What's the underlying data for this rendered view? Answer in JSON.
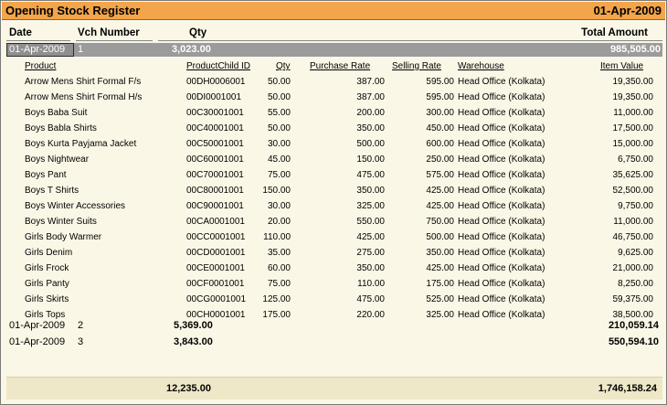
{
  "title": "Opening Stock Register",
  "date": "01-Apr-2009",
  "headers": {
    "date": "Date",
    "vch_number": "Vch Number",
    "qty": "Qty",
    "total_amount": "Total Amount"
  },
  "selected_voucher": {
    "date": "01-Apr-2009",
    "number": "1",
    "qty": "3,023.00",
    "amount": "985,505.00"
  },
  "columns": {
    "product": "Product",
    "child_id": "ProductChild ID",
    "qty": "Qty",
    "purchase_rate": "Purchase Rate",
    "selling_rate": "Selling Rate",
    "warehouse": "Warehouse",
    "item_value": "Item Value"
  },
  "items": [
    {
      "product": "Arrow Mens Shirt Formal F/s",
      "child_id": "00DH0006001",
      "qty": "50.00",
      "purchase_rate": "387.00",
      "selling_rate": "595.00",
      "warehouse": "Head Office (Kolkata)",
      "item_value": "19,350.00"
    },
    {
      "product": "Arrow Mens Shirt Formal H/s",
      "child_id": "00DI0001001",
      "qty": "50.00",
      "purchase_rate": "387.00",
      "selling_rate": "595.00",
      "warehouse": "Head Office (Kolkata)",
      "item_value": "19,350.00"
    },
    {
      "product": "Boys Baba Suit",
      "child_id": "00C30001001",
      "qty": "55.00",
      "purchase_rate": "200.00",
      "selling_rate": "300.00",
      "warehouse": "Head Office (Kolkata)",
      "item_value": "11,000.00"
    },
    {
      "product": "Boys Babla Shirts",
      "child_id": "00C40001001",
      "qty": "50.00",
      "purchase_rate": "350.00",
      "selling_rate": "450.00",
      "warehouse": "Head Office (Kolkata)",
      "item_value": "17,500.00"
    },
    {
      "product": "Boys Kurta Payjama Jacket",
      "child_id": "00C50001001",
      "qty": "30.00",
      "purchase_rate": "500.00",
      "selling_rate": "600.00",
      "warehouse": "Head Office (Kolkata)",
      "item_value": "15,000.00"
    },
    {
      "product": "Boys Nightwear",
      "child_id": "00C60001001",
      "qty": "45.00",
      "purchase_rate": "150.00",
      "selling_rate": "250.00",
      "warehouse": "Head Office (Kolkata)",
      "item_value": "6,750.00"
    },
    {
      "product": "Boys Pant",
      "child_id": "00C70001001",
      "qty": "75.00",
      "purchase_rate": "475.00",
      "selling_rate": "575.00",
      "warehouse": "Head Office (Kolkata)",
      "item_value": "35,625.00"
    },
    {
      "product": "Boys T Shirts",
      "child_id": "00C80001001",
      "qty": "150.00",
      "purchase_rate": "350.00",
      "selling_rate": "425.00",
      "warehouse": "Head Office (Kolkata)",
      "item_value": "52,500.00"
    },
    {
      "product": "Boys Winter Accessories",
      "child_id": "00C90001001",
      "qty": "30.00",
      "purchase_rate": "325.00",
      "selling_rate": "425.00",
      "warehouse": "Head Office (Kolkata)",
      "item_value": "9,750.00"
    },
    {
      "product": "Boys Winter Suits",
      "child_id": "00CA0001001",
      "qty": "20.00",
      "purchase_rate": "550.00",
      "selling_rate": "750.00",
      "warehouse": "Head Office (Kolkata)",
      "item_value": "11,000.00"
    },
    {
      "product": "Girls Body Warmer",
      "child_id": "00CC0001001",
      "qty": "110.00",
      "purchase_rate": "425.00",
      "selling_rate": "500.00",
      "warehouse": "Head Office (Kolkata)",
      "item_value": "46,750.00"
    },
    {
      "product": "Girls Denim",
      "child_id": "00CD0001001",
      "qty": "35.00",
      "purchase_rate": "275.00",
      "selling_rate": "350.00",
      "warehouse": "Head Office (Kolkata)",
      "item_value": "9,625.00"
    },
    {
      "product": "Girls Frock",
      "child_id": "00CE0001001",
      "qty": "60.00",
      "purchase_rate": "350.00",
      "selling_rate": "425.00",
      "warehouse": "Head Office (Kolkata)",
      "item_value": "21,000.00"
    },
    {
      "product": "Girls Panty",
      "child_id": "00CF0001001",
      "qty": "75.00",
      "purchase_rate": "110.00",
      "selling_rate": "175.00",
      "warehouse": "Head Office (Kolkata)",
      "item_value": "8,250.00"
    },
    {
      "product": "Girls Skirts",
      "child_id": "00CG0001001",
      "qty": "125.00",
      "purchase_rate": "475.00",
      "selling_rate": "525.00",
      "warehouse": "Head Office (Kolkata)",
      "item_value": "59,375.00"
    },
    {
      "product": "Girls Tops",
      "child_id": "00CH0001001",
      "qty": "175.00",
      "purchase_rate": "220.00",
      "selling_rate": "325.00",
      "warehouse": "Head Office (Kolkata)",
      "item_value": "38,500.00"
    }
  ],
  "other_vouchers": [
    {
      "date": "01-Apr-2009",
      "number": "2",
      "qty": "5,369.00",
      "amount": "210,059.14"
    },
    {
      "date": "01-Apr-2009",
      "number": "3",
      "qty": "3,843.00",
      "amount": "550,594.10"
    }
  ],
  "totals": {
    "qty": "12,235.00",
    "amount": "1,746,158.24"
  },
  "colors": {
    "titlebar": "#f2a54a",
    "background": "#fbf7e6",
    "selected_row": "#9b9b9b",
    "footer": "#efe8c8"
  }
}
